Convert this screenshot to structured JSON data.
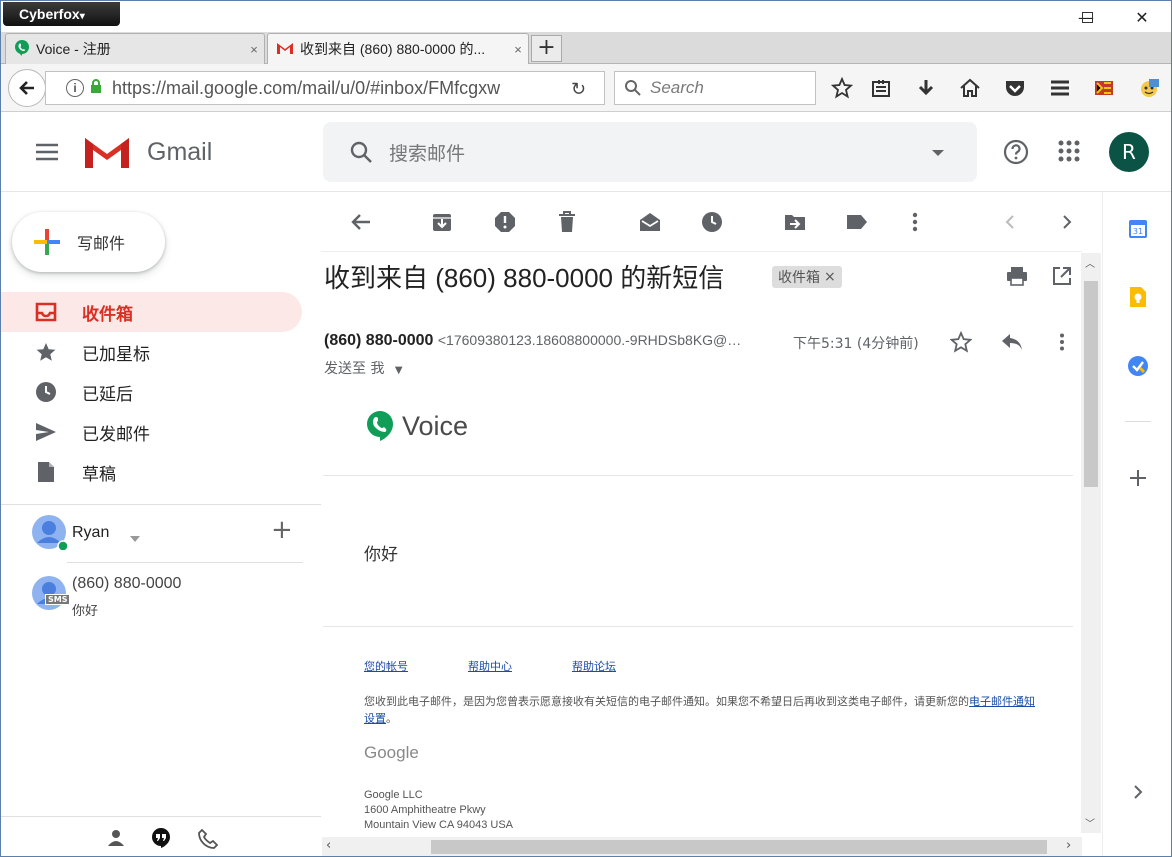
{
  "browser": {
    "app_menu": "Cyberfox",
    "tabs": [
      {
        "title": "Voice - 注册",
        "close": "×"
      },
      {
        "title": "收到来自 (860) 880-0000 的...",
        "close": "×"
      }
    ],
    "new_tab": "+",
    "url": "https://mail.google.com/mail/u/0/#inbox/FMfcgxw",
    "search_placeholder": "Search"
  },
  "gmail": {
    "logo_text": "Gmail",
    "search_placeholder": "搜索邮件",
    "avatar_letter": "R",
    "compose_label": "写邮件",
    "nav": [
      {
        "label": "收件箱",
        "icon": "inbox-icon"
      },
      {
        "label": "已加星标",
        "icon": "star-icon"
      },
      {
        "label": "已延后",
        "icon": "clock-icon"
      },
      {
        "label": "已发邮件",
        "icon": "send-icon"
      },
      {
        "label": "草稿",
        "icon": "draft-icon"
      }
    ],
    "hangouts": {
      "user": "Ryan",
      "add": "+",
      "conversation_name": "(860) 880-0000",
      "conversation_snippet": "你好",
      "sms_badge": "SMS"
    },
    "email": {
      "subject": "收到来自 (860) 880-0000 的新短信",
      "label_chip": "收件箱",
      "label_chip_close": "×",
      "sender_name": "(860) 880-0000",
      "sender_address": "<17609380123.18608800000.-9RHDSb8KG@…",
      "time": "下午5:31 (4分钟前)",
      "to": "发送至 我",
      "voice_logo_text": "Voice",
      "greeting": "你好",
      "footer_links": [
        "您的帐号",
        "帮助中心",
        "帮助论坛"
      ],
      "notice": "您收到此电子邮件，是因为您曾表示愿意接收有关短信的电子邮件通知。如果您不希望日后再收到这类电子邮件，请更新您的",
      "notice_link": "电子邮件通知设置",
      "notice_end": "。",
      "google_logo": "Google",
      "address_lines": [
        "Google LLC",
        "1600 Amphitheatre Pkwy",
        "Mountain View CA 94043 USA"
      ]
    }
  },
  "colors": {
    "accent_red": "#d93025",
    "active_bg": "#fce8e6",
    "voice_green": "#0f9d58",
    "avatar_bg": "#0b5345",
    "link_blue": "#1a4ca8"
  }
}
